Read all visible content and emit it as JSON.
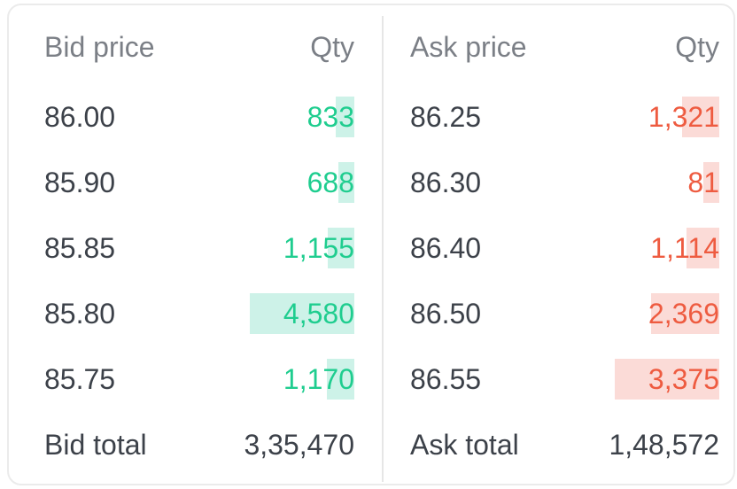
{
  "bid": {
    "header": {
      "price": "Bid price",
      "qty": "Qty"
    },
    "rows": [
      {
        "price": "86.00",
        "qty": "833",
        "fill": 0.18
      },
      {
        "price": "85.90",
        "qty": "688",
        "fill": 0.15
      },
      {
        "price": "85.85",
        "qty": "1,155",
        "fill": 0.25
      },
      {
        "price": "85.80",
        "qty": "4,580",
        "fill": 1.0
      },
      {
        "price": "85.75",
        "qty": "1,170",
        "fill": 0.26
      }
    ],
    "total": {
      "label": "Bid total",
      "value": "3,35,470"
    }
  },
  "ask": {
    "header": {
      "price": "Ask price",
      "qty": "Qty"
    },
    "rows": [
      {
        "price": "86.25",
        "qty": "1,321",
        "fill": 0.36
      },
      {
        "price": "86.30",
        "qty": "81",
        "fill": 0.15
      },
      {
        "price": "86.40",
        "qty": "1,114",
        "fill": 0.31
      },
      {
        "price": "86.50",
        "qty": "2,369",
        "fill": 0.65
      },
      {
        "price": "86.55",
        "qty": "3,375",
        "fill": 1.0
      }
    ],
    "total": {
      "label": "Ask total",
      "value": "1,48,572"
    }
  }
}
